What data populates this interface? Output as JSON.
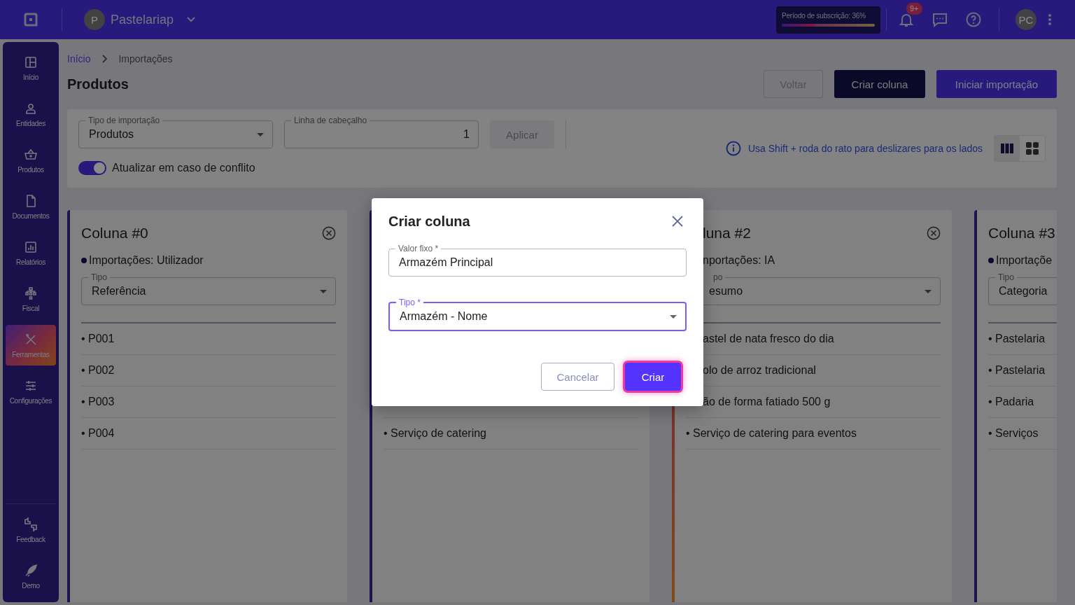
{
  "topbar": {
    "company": {
      "initial": "P",
      "name": "Pastelariap"
    },
    "subscription": {
      "label": "Período de subscrição: 36%",
      "level": 0.36
    },
    "notifications": {
      "badge": "9+"
    },
    "user": {
      "initials": "PC"
    }
  },
  "sidebar": {
    "items": [
      {
        "label": "Início",
        "selected": false
      },
      {
        "label": "Entidades",
        "selected": false
      },
      {
        "label": "Produtos",
        "selected": false
      },
      {
        "label": "Documentos",
        "selected": false
      },
      {
        "label": "Relatórios",
        "selected": false
      },
      {
        "label": "Fiscal",
        "selected": false
      },
      {
        "label": "Ferramentas",
        "selected": true
      },
      {
        "label": "Configurações",
        "selected": false
      }
    ],
    "bottom_items": [
      {
        "label": "Feedback"
      },
      {
        "label": "Demo"
      }
    ]
  },
  "breadcrumb": [
    {
      "label": "Início",
      "link": true
    },
    {
      "label": "Importações",
      "link": false
    }
  ],
  "page_title": "Produtos",
  "actions": [
    {
      "label": "Voltar",
      "kind": "outline"
    },
    {
      "label": "Criar coluna",
      "kind": "dark"
    },
    {
      "label": "Iniciar importação",
      "kind": "primary"
    }
  ],
  "filters": {
    "import_type": {
      "label": "Tipo de importação",
      "value": "Produtos"
    },
    "header_row": {
      "label": "Linha de cabeçalho",
      "value": "1"
    },
    "apply": {
      "label": "Aplicar",
      "disabled": true
    },
    "update_on_conflict": {
      "label": "Atualizar em caso de conflito",
      "on": true
    },
    "hint": "Usa Shift + roda do rato para deslizares para os lados",
    "views": [
      {
        "selected": true
      },
      {
        "selected": false
      }
    ]
  },
  "columns": [
    {
      "title": "Coluna #0",
      "source": "Importações: Utilizador",
      "type_label": "Tipo",
      "type_value": "Referência",
      "highlighted": false,
      "rows": [
        "• P001",
        "• P002",
        "• P003",
        "• P004"
      ]
    },
    {
      "highlighted": false,
      "rows": [
        "• Serviço de catering"
      ]
    },
    {
      "title": "luna #2",
      "source": "nportações: IA",
      "type_label": "po",
      "type_value": "esumo",
      "highlighted": true,
      "rows": [
        "astel de nata fresco do dia",
        "olo de arroz tradicional",
        "ão de forma fatiado 500 g",
        "• Serviço de catering para eventos"
      ]
    },
    {
      "title": "Coluna #3",
      "source": "Importaçõe",
      "type_label": "Tipo",
      "type_value": "Categoria",
      "highlighted": false,
      "rows": [
        "• Pastelaria",
        "• Pastelaria",
        "• Padaria",
        "• Serviços"
      ]
    }
  ],
  "dialog": {
    "title": "Criar coluna",
    "fields": [
      {
        "label": "Valor fixo *",
        "value": "Armazém Principal",
        "kind": "text",
        "focused": false
      },
      {
        "label": "Tipo *",
        "value": "Armazém - Nome",
        "kind": "select",
        "focused": true
      }
    ],
    "buttons": [
      {
        "label": "Cancelar",
        "kind": "outline"
      },
      {
        "label": "Criar",
        "kind": "primary"
      }
    ]
  }
}
